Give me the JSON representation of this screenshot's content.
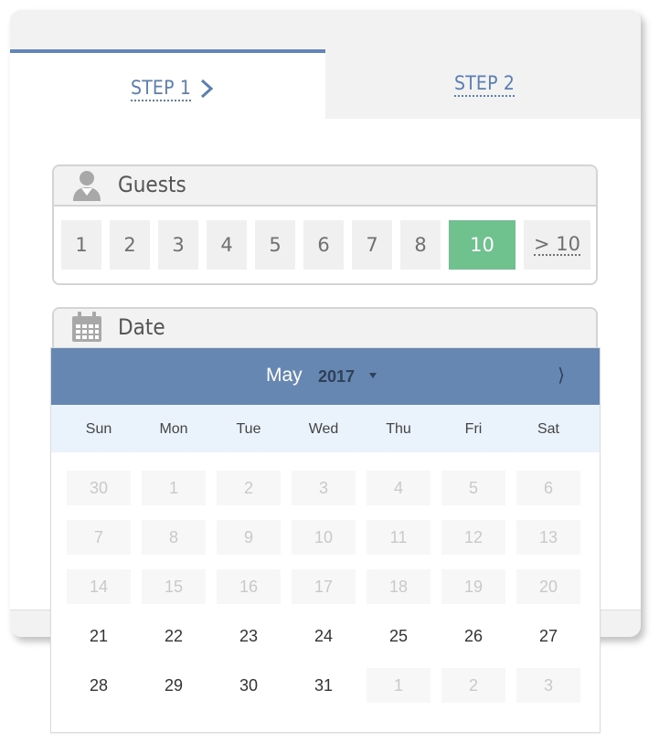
{
  "steps": {
    "step1": "STEP 1",
    "step2": "STEP 2"
  },
  "guests": {
    "title": "Guests",
    "options": [
      "1",
      "2",
      "3",
      "4",
      "5",
      "6",
      "7",
      "8",
      "10",
      "> 10"
    ],
    "selected": "10"
  },
  "date": {
    "title": "Date"
  },
  "calendar": {
    "month": "May",
    "year": "2017",
    "next_icon": "chevron-right-icon",
    "weekdays": [
      "Sun",
      "Mon",
      "Tue",
      "Wed",
      "Thu",
      "Fri",
      "Sat"
    ],
    "weeks": [
      [
        {
          "d": "30",
          "off": true
        },
        {
          "d": "1",
          "off": true
        },
        {
          "d": "2",
          "off": true
        },
        {
          "d": "3",
          "off": true
        },
        {
          "d": "4",
          "off": true
        },
        {
          "d": "5",
          "off": true
        },
        {
          "d": "6",
          "off": true
        }
      ],
      [
        {
          "d": "7",
          "off": true
        },
        {
          "d": "8",
          "off": true
        },
        {
          "d": "9",
          "off": true
        },
        {
          "d": "10",
          "off": true
        },
        {
          "d": "11",
          "off": true
        },
        {
          "d": "12",
          "off": true
        },
        {
          "d": "13",
          "off": true
        }
      ],
      [
        {
          "d": "14",
          "off": true
        },
        {
          "d": "15",
          "off": true
        },
        {
          "d": "16",
          "off": true
        },
        {
          "d": "17",
          "off": true
        },
        {
          "d": "18",
          "off": true
        },
        {
          "d": "19",
          "off": true
        },
        {
          "d": "20",
          "off": true
        }
      ],
      [
        {
          "d": "21",
          "off": false
        },
        {
          "d": "22",
          "off": false
        },
        {
          "d": "23",
          "off": false
        },
        {
          "d": "24",
          "off": false
        },
        {
          "d": "25",
          "off": false
        },
        {
          "d": "26",
          "off": false
        },
        {
          "d": "27",
          "off": false
        }
      ],
      [
        {
          "d": "28",
          "off": false
        },
        {
          "d": "29",
          "off": false
        },
        {
          "d": "30",
          "off": false
        },
        {
          "d": "31",
          "off": false
        },
        {
          "d": "1",
          "off": true
        },
        {
          "d": "2",
          "off": true
        },
        {
          "d": "3",
          "off": true
        }
      ]
    ]
  },
  "colors": {
    "accent": "#6587b2",
    "selected_green": "#6fc28e",
    "weekday_bg": "#eaf3fc"
  }
}
